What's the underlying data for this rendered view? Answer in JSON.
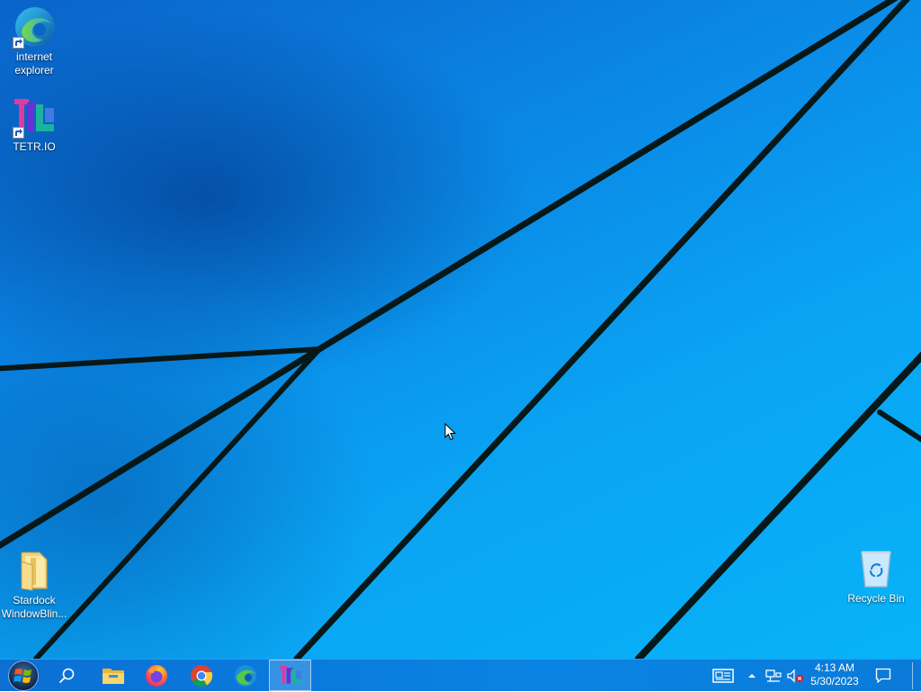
{
  "desktop": {
    "icons": [
      {
        "label": "internet explorer",
        "icon": "edge-icon",
        "shortcut": true
      },
      {
        "label": "TETR.IO",
        "icon": "tetrio-icon",
        "shortcut": true
      },
      {
        "label": "Stardock WindowBlin...",
        "icon": "folder-icon",
        "shortcut": false
      },
      {
        "label": "Recycle Bin",
        "icon": "recycle-bin-icon",
        "shortcut": false
      }
    ]
  },
  "taskbar": {
    "start": "windows-start-icon",
    "search": "search-icon",
    "pinned": [
      "file-explorer-icon",
      "firefox-icon",
      "chrome-icon",
      "edge-icon",
      "tetrio-icon"
    ],
    "active_app": "tetrio-icon",
    "tray": [
      "news-widget-icon",
      "show-hidden-icons-chevron",
      "network-icon",
      "volume-muted-icon"
    ],
    "clock": {
      "time": "4:13 AM",
      "date": "5/30/2023"
    },
    "notifications": "action-center-icon"
  },
  "colors": {
    "taskbar": "#0a84e4",
    "desktop": "#0aa4f3",
    "wallpaper_lines": "#0a1a1a"
  }
}
